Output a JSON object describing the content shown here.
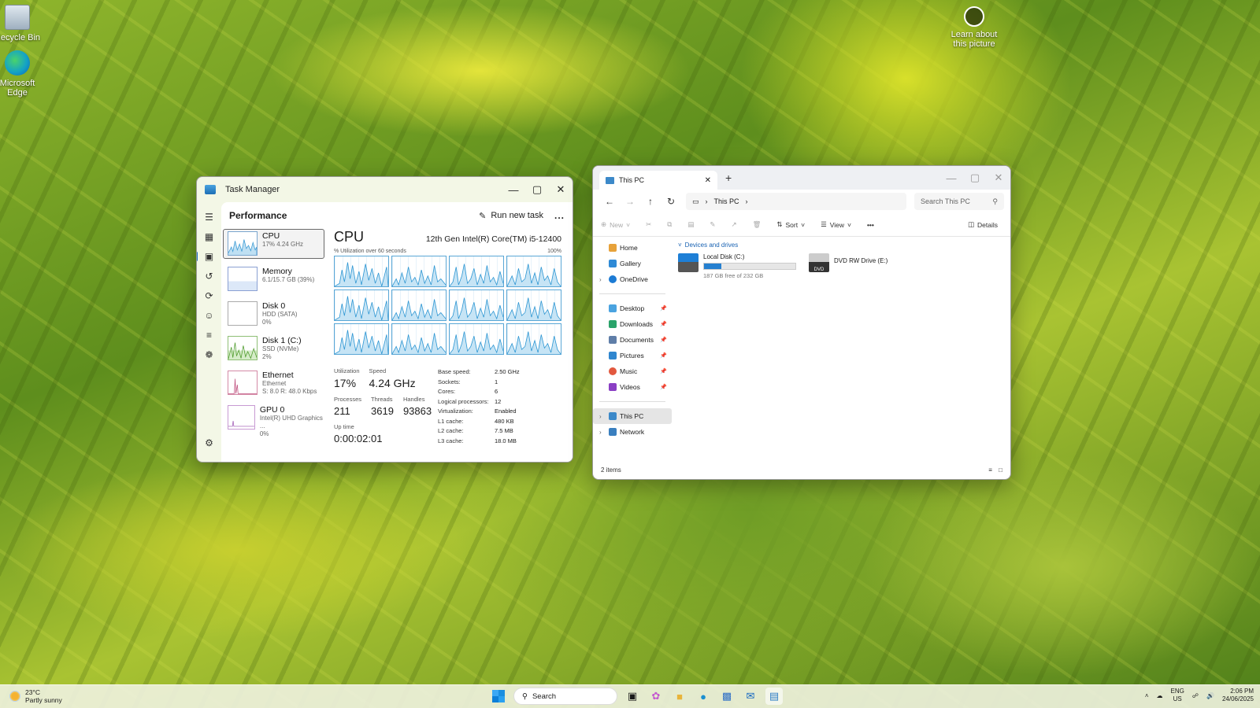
{
  "desktop": {
    "icons": [
      {
        "label": "Recycle Bin",
        "icon": "recycle-bin-icon"
      },
      {
        "label": "Microsoft Edge",
        "icon": "edge-icon"
      }
    ],
    "learn_about": "Learn about this picture"
  },
  "task_manager": {
    "title": "Task Manager",
    "section": "Performance",
    "run_new_task": "Run new task",
    "more": "...",
    "resources": [
      {
        "name": "CPU",
        "sub": "17% 4.24 GHz",
        "sub2": ""
      },
      {
        "name": "Memory",
        "sub": "6.1/15.7 GB (39%)",
        "sub2": ""
      },
      {
        "name": "Disk 0",
        "sub": "HDD (SATA)",
        "sub2": "0%"
      },
      {
        "name": "Disk 1 (C:)",
        "sub": "SSD (NVMe)",
        "sub2": "2%"
      },
      {
        "name": "Ethernet",
        "sub": "Ethernet",
        "sub2": "S: 8.0  R: 48.0 Kbps"
      },
      {
        "name": "GPU 0",
        "sub": "Intel(R) UHD Graphics ...",
        "sub2": "0%"
      }
    ],
    "cpu": {
      "title": "CPU",
      "model": "12th Gen Intel(R) Core(TM) i5-12400",
      "axis_left": "% Utilization over 60 seconds",
      "axis_right": "100%",
      "utilization_label": "Utilization",
      "utilization": "17%",
      "speed_label": "Speed",
      "speed": "4.24 GHz",
      "processes_label": "Processes",
      "processes": "211",
      "threads_label": "Threads",
      "threads": "3619",
      "handles_label": "Handles",
      "handles": "93863",
      "uptime_label": "Up time",
      "uptime": "0:00:02:01",
      "specs": [
        {
          "k": "Base speed:",
          "v": "2.50 GHz"
        },
        {
          "k": "Sockets:",
          "v": "1"
        },
        {
          "k": "Cores:",
          "v": "6"
        },
        {
          "k": "Logical processors:",
          "v": "12"
        },
        {
          "k": "Virtualization:",
          "v": "Enabled"
        },
        {
          "k": "L1 cache:",
          "v": "480 KB"
        },
        {
          "k": "L2 cache:",
          "v": "7.5 MB"
        },
        {
          "k": "L3 cache:",
          "v": "18.0 MB"
        }
      ]
    }
  },
  "explorer": {
    "tab_title": "This PC",
    "breadcrumb": "This PC",
    "search_placeholder": "Search This PC",
    "toolbar": {
      "new": "New",
      "sort": "Sort",
      "view": "View",
      "details": "Details"
    },
    "sidebar": {
      "top": [
        {
          "label": "Home",
          "chev": false
        },
        {
          "label": "Gallery",
          "chev": false
        },
        {
          "label": "OneDrive",
          "chev": true
        }
      ],
      "pinned": [
        {
          "label": "Desktop"
        },
        {
          "label": "Downloads"
        },
        {
          "label": "Documents"
        },
        {
          "label": "Pictures"
        },
        {
          "label": "Music"
        },
        {
          "label": "Videos"
        }
      ],
      "bottom": [
        {
          "label": "This PC"
        },
        {
          "label": "Network"
        }
      ]
    },
    "group_label": "Devices and drives",
    "drives": [
      {
        "name": "Local Disk (C:)",
        "free": "187 GB free of 232 GB",
        "used_fraction": 0.19
      },
      {
        "name": "DVD RW Drive (E:)",
        "label": "DVD"
      }
    ],
    "status": "2 items"
  },
  "taskbar": {
    "temperature": "23°C",
    "condition": "Partly sunny",
    "search_label": "Search",
    "lang": "ENG",
    "region": "US",
    "time": "2:06 PM",
    "date": "24/06/2025"
  }
}
